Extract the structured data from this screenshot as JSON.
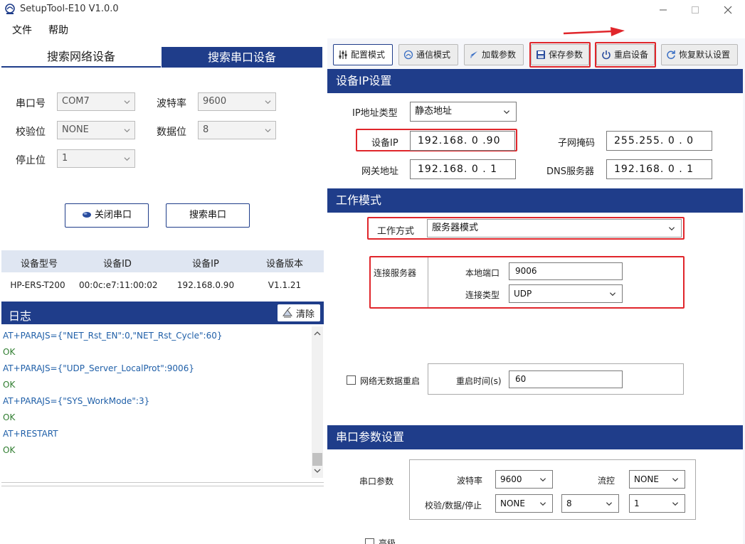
{
  "window": {
    "title": "SetupTool-E10 V1.0.0"
  },
  "menu": {
    "file": "文件",
    "help": "帮助"
  },
  "left": {
    "tabs": {
      "network": "搜索网络设备",
      "serial": "搜索串口设备"
    },
    "serial_form": {
      "port_label": "串口号",
      "port_value": "COM7",
      "baud_label": "波特率",
      "baud_value": "9600",
      "parity_label": "校验位",
      "parity_value": "NONE",
      "databits_label": "数据位",
      "databits_value": "8",
      "stopbits_label": "停止位",
      "stopbits_value": "1"
    },
    "buttons": {
      "close_port": "关闭串口",
      "search_port": "搜索串口"
    },
    "device_table": {
      "headers": [
        "设备型号",
        "设备ID",
        "设备IP",
        "设备版本"
      ],
      "rows": [
        {
          "model": "HP-ERS-T200",
          "id": "00:0c:e7:11:00:02",
          "ip": "192.168.0.90",
          "version": "V1.1.21"
        }
      ]
    },
    "log": {
      "title": "日志",
      "clear_label": "清除",
      "lines": [
        {
          "text": "AT+PARAJS={\"NET_Rst_EN\":0,\"NET_Rst_Cycle\":60}",
          "type": "cmd"
        },
        {
          "text": "OK",
          "type": "ok"
        },
        {
          "text": "AT+PARAJS={\"UDP_Server_LocalProt\":9006}",
          "type": "cmd"
        },
        {
          "text": "OK",
          "type": "ok"
        },
        {
          "text": "AT+PARAJS={\"SYS_WorkMode\":3}",
          "type": "cmd"
        },
        {
          "text": "OK",
          "type": "ok"
        },
        {
          "text": "AT+RESTART",
          "type": "cmd"
        },
        {
          "text": "OK",
          "type": "ok"
        }
      ]
    }
  },
  "toolbar": {
    "config_mode": "配置模式",
    "comm_mode": "通信模式",
    "load_params": "加载参数",
    "save_params": "保存参数",
    "restart_device": "重启设备",
    "restore_default": "恢复默认设置"
  },
  "ip_settings": {
    "title": "设备IP设置",
    "ip_type_label": "IP地址类型",
    "ip_type_value": "静态地址",
    "device_ip_label": "设备IP",
    "device_ip": [
      "192",
      "168",
      "0",
      "90"
    ],
    "subnet_label": "子网掩码",
    "subnet": [
      "255",
      "255",
      "0",
      "0"
    ],
    "gateway_label": "网关地址",
    "gateway": [
      "192",
      "168",
      "0",
      "1"
    ],
    "dns_label": "DNS服务器",
    "dns": [
      "192",
      "168",
      "0",
      "1"
    ]
  },
  "work_mode": {
    "title": "工作模式",
    "mode_label": "工作方式",
    "mode_value": "服务器模式",
    "connect_label": "连接服务器",
    "local_port_label": "本地端口",
    "local_port_value": "9006",
    "conn_type_label": "连接类型",
    "conn_type_value": "UDP",
    "no_data_restart_label": "网络无数据重启",
    "restart_time_label": "重启时间(s)",
    "restart_time_value": "60"
  },
  "serial_params": {
    "title": "串口参数设置",
    "group_label": "串口参数",
    "baud_label": "波特率",
    "baud_value": "9600",
    "flow_label": "流控",
    "flow_value": "NONE",
    "pds_label": "校验/数据/停止",
    "parity_value": "NONE",
    "databits_value": "8",
    "stopbits_value": "1",
    "advanced_label": "高级"
  }
}
